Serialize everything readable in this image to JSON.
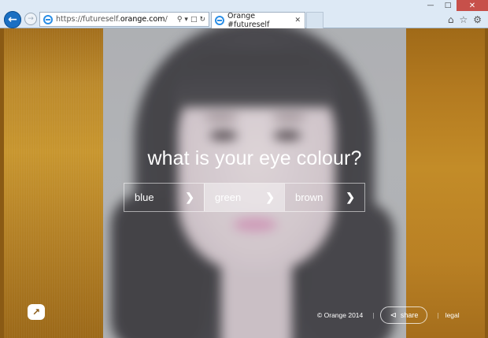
{
  "browser": {
    "url_prefix": "https://futureself.",
    "url_host": "orange.com",
    "url_suffix": "/",
    "tab_title": "Orange #futureself",
    "icons": [
      "back-icon",
      "forward-icon",
      "ie-logo-icon",
      "search-icon",
      "lock-icon",
      "refresh-icon",
      "home-icon",
      "star-icon",
      "gear-icon"
    ]
  },
  "page": {
    "question": "what is your eye colour?",
    "options": [
      {
        "label": "blue",
        "selected": false
      },
      {
        "label": "green",
        "selected": true
      },
      {
        "label": "brown",
        "selected": false
      }
    ],
    "footer": {
      "copyright": "© Orange 2014",
      "share_label": "share",
      "legal_label": "legal"
    },
    "colors": {
      "side_panel": "#b98428",
      "hover_option": "#cdced0"
    }
  }
}
